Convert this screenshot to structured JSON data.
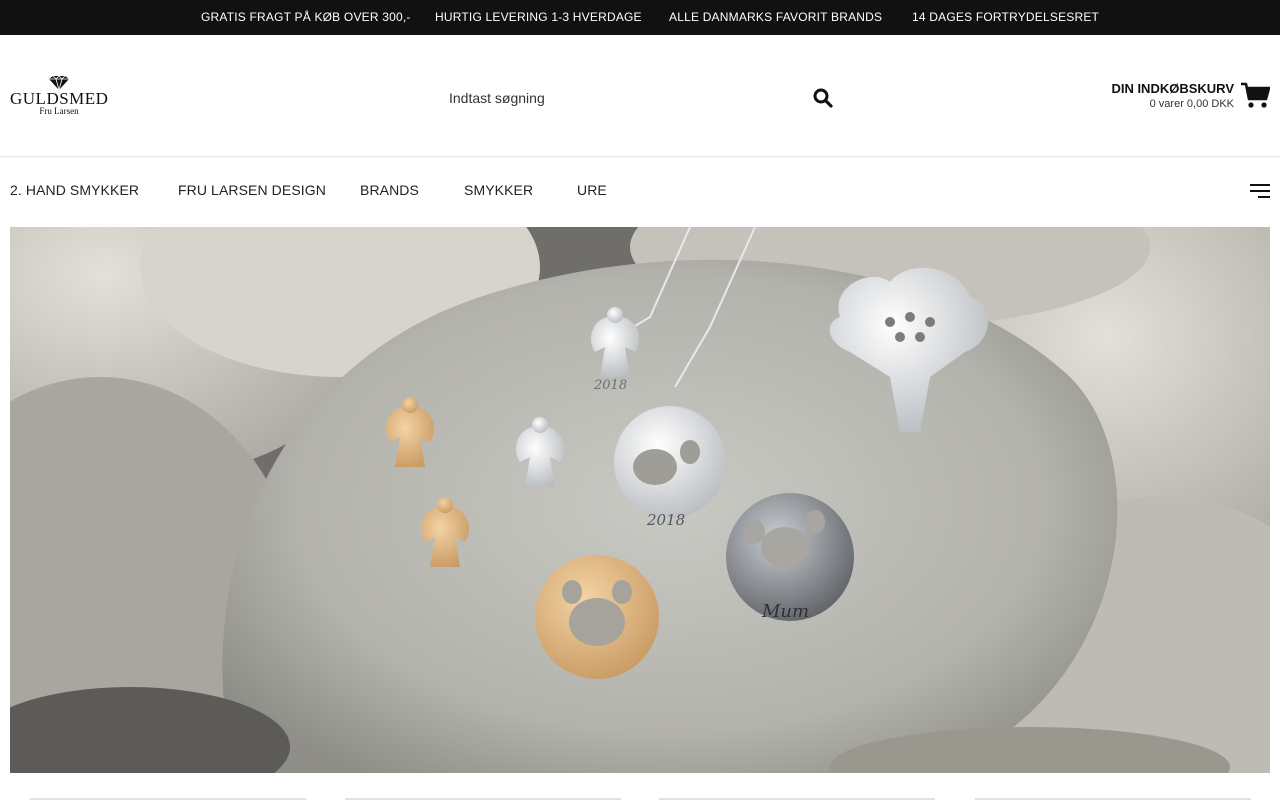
{
  "topbar": {
    "items": [
      "GRATIS FRAGT PÅ KØB OVER 300,-",
      "HURTIG LEVERING 1-3 HVERDAGE",
      "ALLE DANMARKS FAVORIT BRANDS",
      "14 DAGES FORTRYDELSESRET"
    ]
  },
  "header": {
    "logo": {
      "main": "GULDSMED",
      "sub": "Fru Larsen"
    },
    "search": {
      "placeholder": "Indtast søgning",
      "value": ""
    },
    "cart": {
      "title": "DIN INDKØBSKURV",
      "info": "0 varer 0,00 DKK"
    }
  },
  "nav": {
    "items": [
      "2. HAND SMYKKER",
      "FRU LARSEN DESIGN",
      "BRANDS",
      "SMYKKER",
      "URE"
    ]
  },
  "hero": {
    "engravings": [
      "2018",
      "2018",
      "Mum"
    ]
  },
  "colors": {
    "topbar_bg": "#111111",
    "accent": "#111111",
    "text": "#222222"
  },
  "icons": {
    "search": "search-icon",
    "cart": "shopping-cart-icon",
    "menu": "hamburger-menu-icon",
    "logo": "diamond-icon"
  }
}
